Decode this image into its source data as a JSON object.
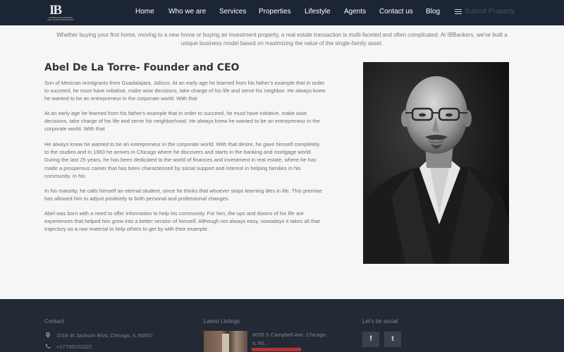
{
  "header": {
    "logo_text": "IB",
    "logo_subtext": "INTERNATIONAL BANKERS REAL ESTATE CORPORATION",
    "nav": [
      "Home",
      "Who we are",
      "Services",
      "Properties",
      "Lifestyle",
      "Agents",
      "Contact us",
      "Blog"
    ],
    "submit_label": "Submit Property"
  },
  "intro": {
    "line1": "Whether buying your first home, moving to a new home or buying an investment property, a real estate transaction is multi-faceted and often complicated. At IBBankers, we've built a",
    "line2": "unique business model based on maximizing the value of the single-family asset."
  },
  "main": {
    "title": "Abel De La Torre- Founder and CEO",
    "paragraphs": [
      {
        "lines": [
          "Son of Mexican immigrants from Guadalajara, Jalisco. At an early age he learned from his father's example that in order",
          "to succeed, he must have initiative, make wise decisions, take charge of his life and serve his neighbor. He always knew",
          "he wanted to be an entrepreneur in the corporate world. With that"
        ]
      },
      {
        "lines": [
          "At an early age he learned from his father's example that in order to succeed, he must have initiative, make wise",
          "decisions, take charge of his life and serve his neighborhood. He always knew he wanted to be an entrepreneur in the",
          "corporate world. With that"
        ]
      },
      {
        "lines": [
          "He always knew he wanted to be an entrepreneur in the corporate world. With that desire, he gave himself completely",
          "to the studies and in 1993 he arrives in Chicago where he discovers and starts in the banking and mortgage world.",
          " During the last 25 years, he has been dedicated to the world of finances and investment in real estate, where he has",
          "made a prosperous career that has been characterized by social support and interest in helping families in his",
          "community. In his"
        ]
      },
      {
        "lines": [
          "In his maturity, he calls himself an eternal student, since he thinks that whoever stops learning dies in life. This premise",
          "has allowed him to adjust positively to both personal and professional changes."
        ]
      },
      {
        "lines": [
          "Abel was born with a need to offer information to help his community. For him, the ups and downs of his life are",
          "experiences that helped him grow into a better version of himself. Although not always easy, nowadays it takes all that",
          "trajectory as a raw material to help others to get by with their example."
        ]
      }
    ]
  },
  "footer": {
    "contact": {
      "heading": "Contact",
      "address": "1016 W Jackson Blvd, Chicago, IL 60607",
      "phone": "+17735222222"
    },
    "listings": {
      "heading": "Latest Listings",
      "line1": "6035 S Campbell Ave, Chicago,",
      "line2": "IL 60..."
    },
    "social": {
      "heading": "Let's be social",
      "facebook": "f",
      "twitter": "t"
    }
  },
  "icons": {
    "location": "map-marker-icon",
    "phone": "phone-icon",
    "menu": "hamburger-menu-icon"
  }
}
